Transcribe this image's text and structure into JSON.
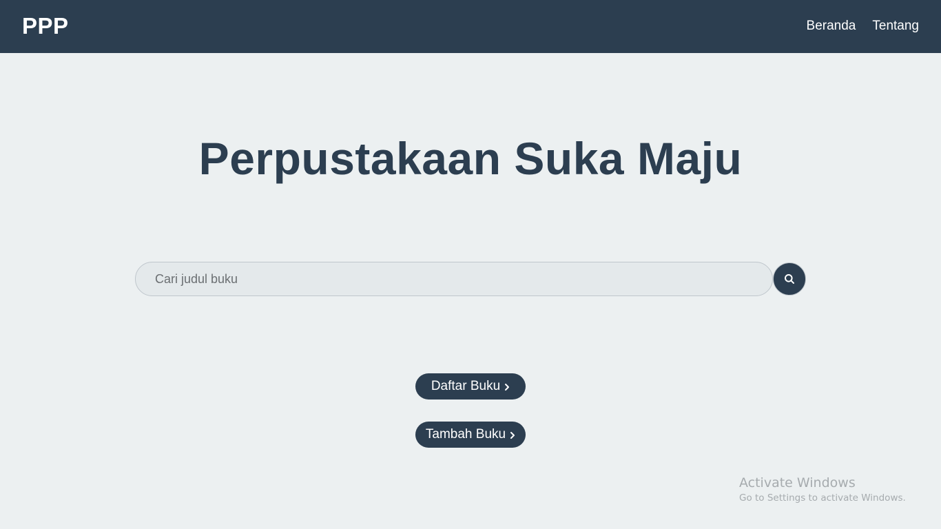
{
  "navbar": {
    "brand": "PPP",
    "links": [
      "Beranda",
      "Tentang"
    ]
  },
  "hero": {
    "title": "Perpustakaan Suka Maju"
  },
  "search": {
    "placeholder": "Cari judul buku",
    "value": "",
    "button_icon": "search-icon"
  },
  "actions": {
    "daftar_label": "Daftar Buku",
    "tambah_label": "Tambah Buku",
    "chevron_icon": "chevron-right-icon"
  },
  "watermark": {
    "title": "Activate Windows",
    "subtitle": "Go to Settings to activate Windows."
  },
  "colors": {
    "primary": "#2c3e50",
    "background": "#ecf0f1",
    "text_on_primary": "#ffffff",
    "input_background": "#e4e9eb"
  }
}
